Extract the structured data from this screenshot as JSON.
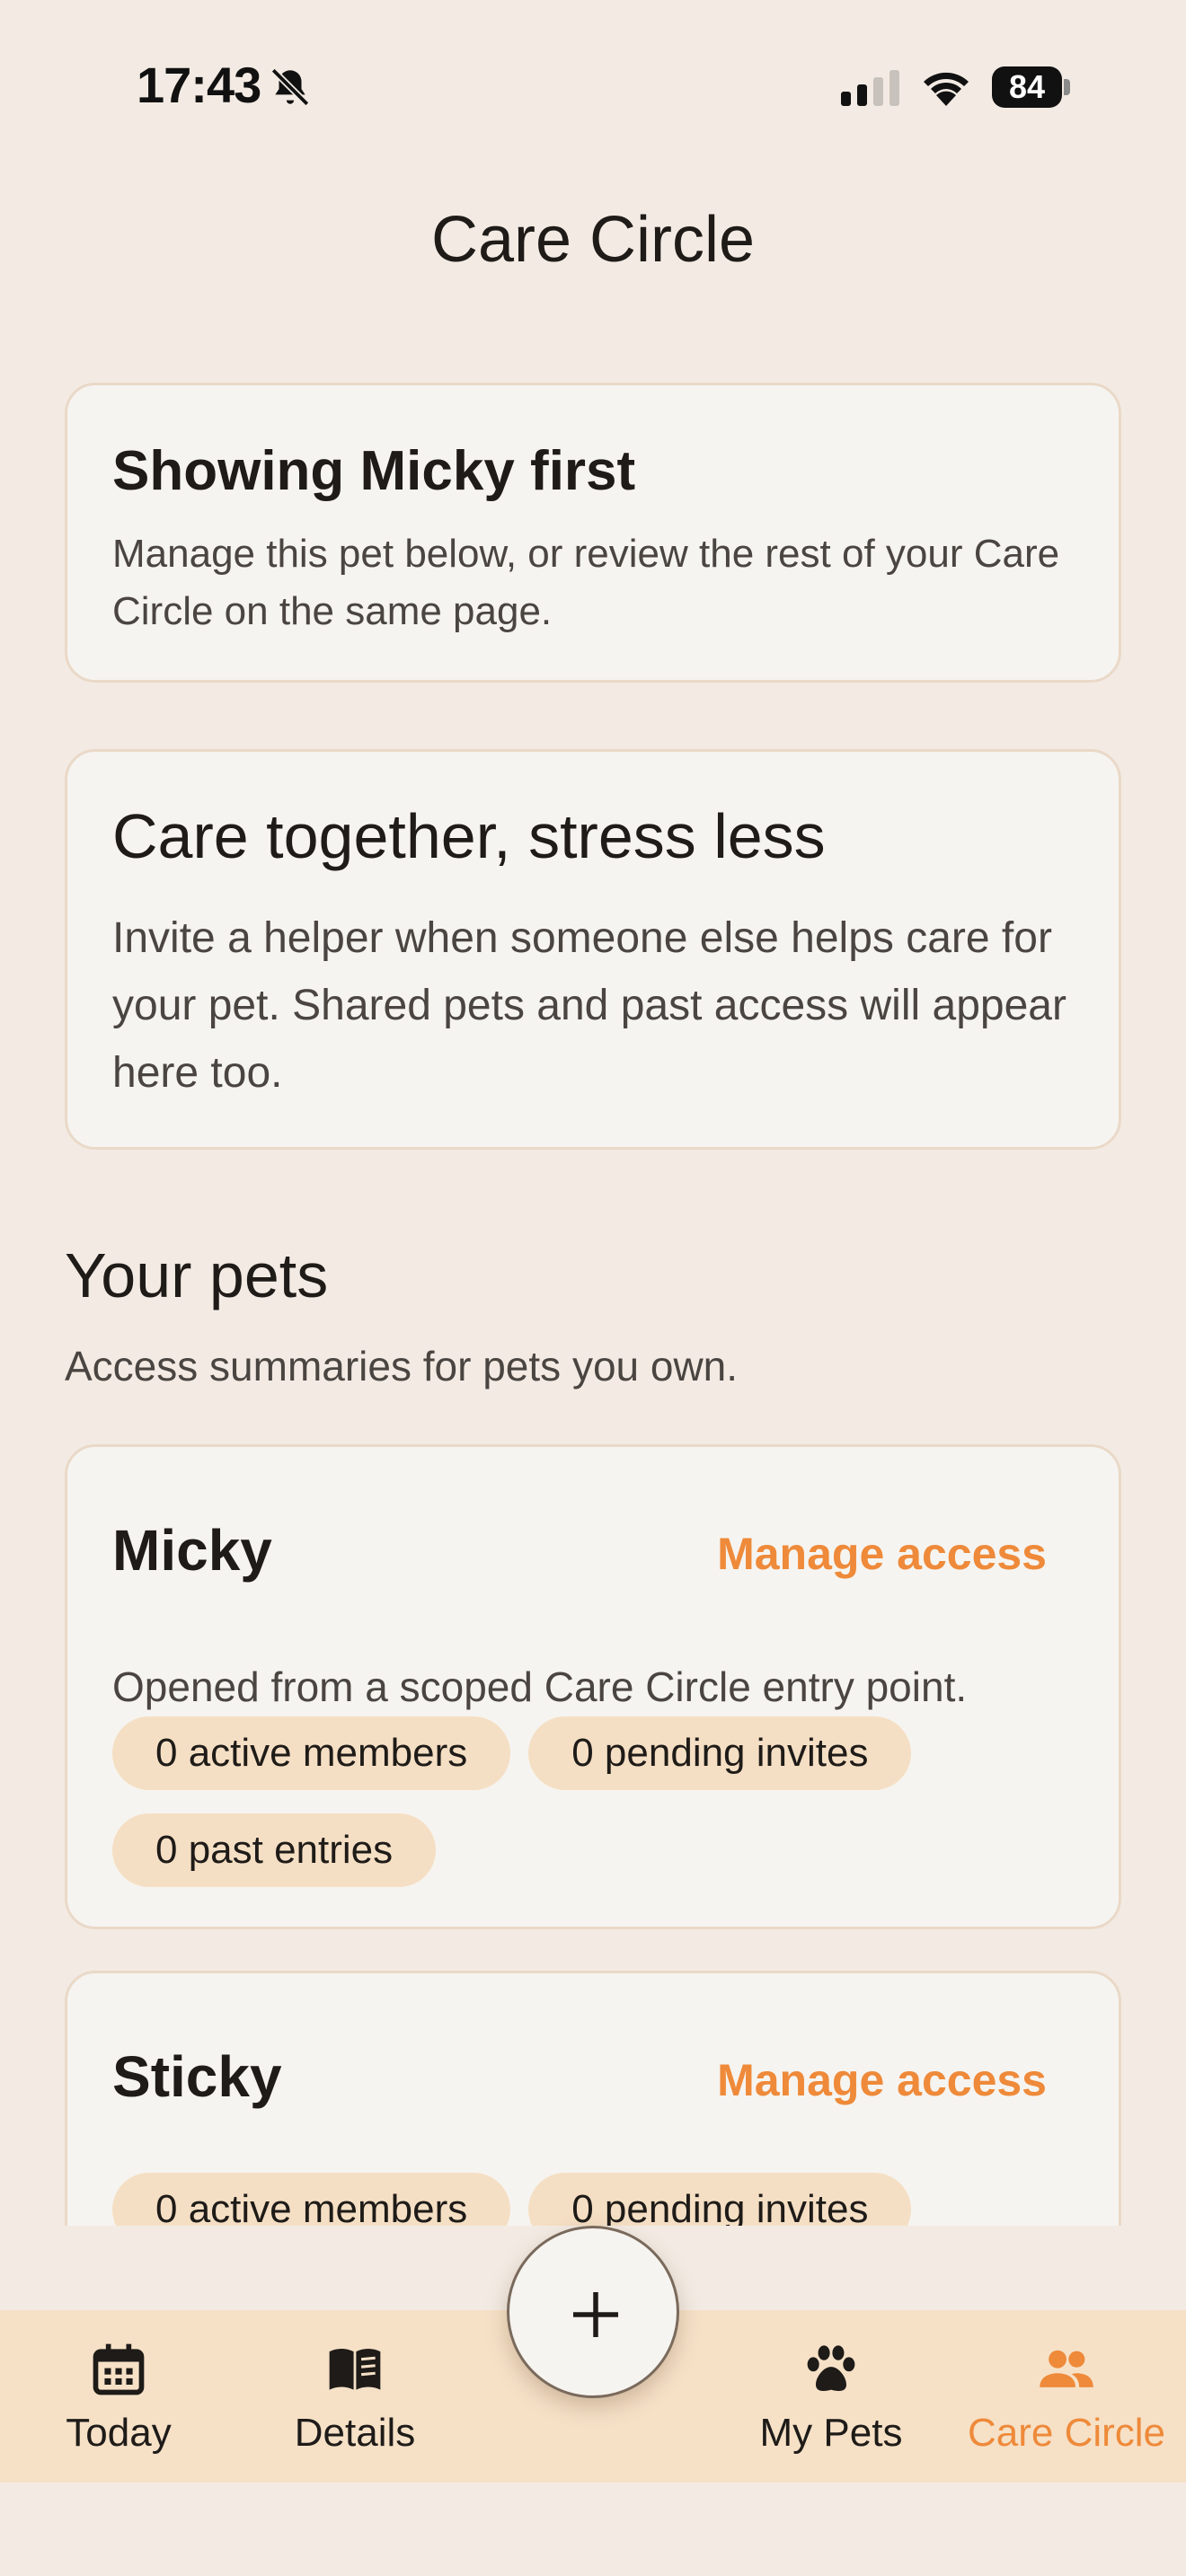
{
  "status_bar": {
    "time": "17:43",
    "battery": "84",
    "icons": [
      "bell-slash-icon",
      "signal-icon",
      "wifi-icon",
      "battery-icon"
    ]
  },
  "header": {
    "title": "Care Circle"
  },
  "focus_card": {
    "heading": "Showing Micky first",
    "body": "Manage this pet below, or review the rest of your Care Circle on the same page."
  },
  "intro_card": {
    "heading": "Care together, stress less",
    "body": "Invite a helper when someone else helps care for your pet. Shared pets and past access will appear here too."
  },
  "your_pets": {
    "title": "Your pets",
    "subtitle": "Access summaries for pets you own.",
    "pets": [
      {
        "name": "Micky",
        "manage_label": "Manage access",
        "description": "Opened from a scoped Care Circle entry point.",
        "chips": [
          "0 active members",
          "0 pending invites",
          "0 past entries"
        ]
      },
      {
        "name": "Sticky",
        "manage_label": "Manage access",
        "chips": [
          "0 active members",
          "0 pending invites"
        ]
      }
    ]
  },
  "bottom_nav": {
    "items": [
      {
        "label": "Today",
        "icon": "calendar-icon"
      },
      {
        "label": "Details",
        "icon": "book-icon"
      },
      {
        "label": "My Pets",
        "icon": "paw-icon"
      },
      {
        "label": "Care Circle",
        "icon": "people-icon",
        "active": true
      }
    ],
    "fab_icon": "plus-icon"
  },
  "colors": {
    "background": "#F3EBE3",
    "card": "#F6F4F0",
    "accent": "#EE8A3A",
    "chip": "#F5DFC4",
    "nav": "#F6E1C7"
  }
}
